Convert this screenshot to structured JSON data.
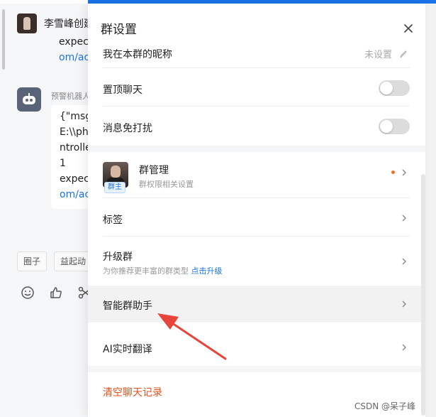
{
  "chat": {
    "title": "李雪峰创建",
    "msg1_line1": "expec",
    "msg1_line2": "om/ac",
    "bot_label": "预警机器人",
    "msg2_lines": [
      "{\"msg\"",
      "E:\\\\php",
      "ntrolle",
      "1",
      "expect",
      "om/ac"
    ],
    "chips": [
      "圈子",
      "益起动"
    ]
  },
  "panel": {
    "title": "群设置",
    "partial_row_label": "我在本群的昵称",
    "partial_row_value": "未设置",
    "pin_chat": "置顶聊天",
    "mute": "消息免打扰",
    "group_manage": "群管理",
    "group_manage_sub": "群权限相关设置",
    "owner_badge": "群主",
    "tags": "标签",
    "upgrade": "升级群",
    "upgrade_sub": "为你推荐更丰富的群类型",
    "upgrade_link": "点击升级",
    "smart_assistant": "智能群助手",
    "ai_translate": "AI实时翻译",
    "clear_history": "清空聊天记录"
  },
  "toggles": {
    "pin_chat": false,
    "mute": false
  },
  "colors": {
    "accent": "#1a73e8",
    "danger": "#e0521c",
    "arrow": "#e8443a"
  },
  "watermark": "CSDN @呆子峰"
}
